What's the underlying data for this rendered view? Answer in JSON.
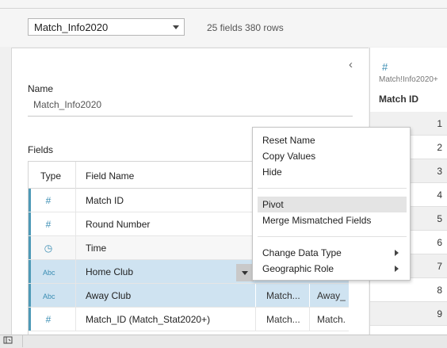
{
  "toolbar": {
    "datasource_select": "Match_Info2020",
    "stats": "25 fields 380 rows"
  },
  "panel": {
    "name_label": "Name",
    "name_value": "Match_Info2020",
    "fields_label": "Fields",
    "collapse_glyph": "‹",
    "columns": {
      "type": "Type",
      "field_name": "Field Name"
    },
    "rows": [
      {
        "icon": "#",
        "name": "Match ID",
        "icon_name": "number-icon"
      },
      {
        "icon": "#",
        "name": "Round Number",
        "icon_name": "number-icon"
      },
      {
        "icon": "◷",
        "name": "Time",
        "icon_name": "datetime-icon"
      },
      {
        "icon": "Abc",
        "name": "Home Club",
        "icon_name": "string-icon"
      },
      {
        "icon": "Abc",
        "name": "Away Club",
        "icon_name": "string-icon",
        "extra1": "Match...",
        "extra2": "Away_"
      },
      {
        "icon": "#",
        "name": "Match_ID (Match_Stat2020+)",
        "icon_name": "number-icon",
        "extra1": "Match...",
        "extra2": "Match."
      }
    ]
  },
  "grid": {
    "type_icon": "#",
    "source": "Match!Info2020+",
    "column": "Match ID",
    "values": [
      "1",
      "2",
      "3",
      "4",
      "5",
      "6",
      "7",
      "8",
      "9"
    ]
  },
  "context_menu": {
    "items": [
      {
        "label": "Reset Name"
      },
      {
        "label": "Copy Values"
      },
      {
        "label": "Hide"
      },
      {
        "label": "Pivot"
      },
      {
        "label": "Merge Mismatched Fields"
      },
      {
        "label": "Change Data Type"
      },
      {
        "label": "Geographic Role"
      }
    ]
  },
  "colors": {
    "accent": "#4e9ab7",
    "selection": "#cfe3f1"
  }
}
